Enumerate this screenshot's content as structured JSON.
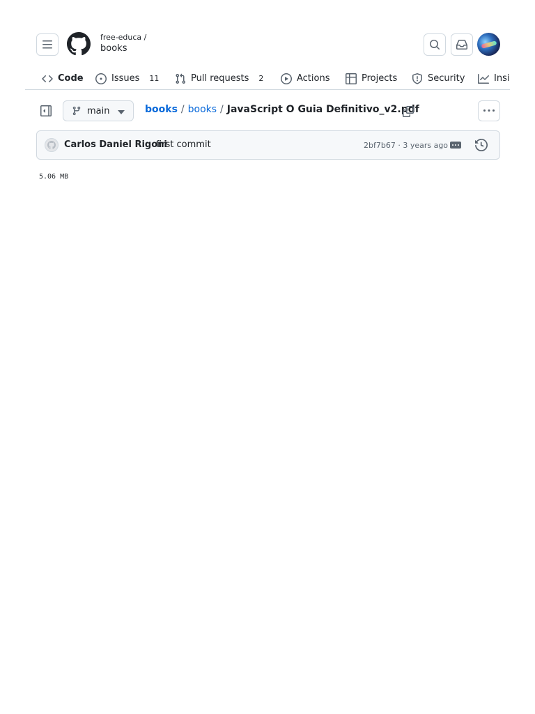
{
  "header": {
    "owner": "free-educa /",
    "repo": "books"
  },
  "tabs": [
    {
      "label": "Code",
      "icon": "code-icon",
      "selected": true
    },
    {
      "label": "Issues",
      "icon": "issue-icon",
      "count": "11"
    },
    {
      "label": "Pull requests",
      "icon": "pull-request-icon",
      "count": "2"
    },
    {
      "label": "Actions",
      "icon": "play-icon"
    },
    {
      "label": "Projects",
      "icon": "table-icon"
    },
    {
      "label": "Security",
      "icon": "shield-icon"
    },
    {
      "label": "Insights",
      "icon": "graph-icon"
    }
  ],
  "branch": {
    "name": "main"
  },
  "breadcrumb": {
    "root": "books",
    "folder": "books",
    "file": "JavaScript O Guia Definitivo_v2.pdf",
    "separator": "/"
  },
  "commit": {
    "author": "Carlos Daniel Rigoni",
    "message": "first commit",
    "meta": "2bf7b67 · 3 years ago"
  },
  "file": {
    "size": "5.06 MB"
  },
  "colors": {
    "link": "#0969da",
    "border": "#d1d9e0",
    "tab_underline": "#fd8c73",
    "muted": "#59636e"
  }
}
